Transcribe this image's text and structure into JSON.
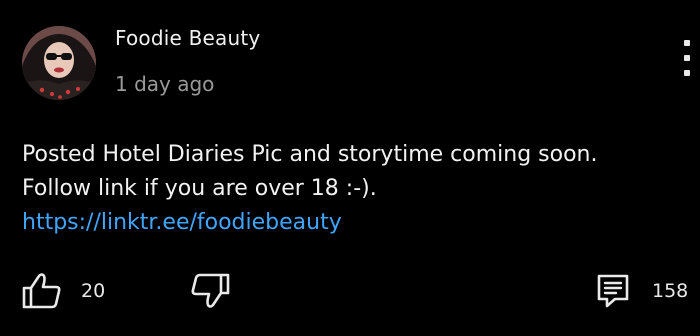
{
  "post": {
    "author": "Foodie Beauty",
    "timestamp": "1 day ago",
    "text_line1": "Posted Hotel Diaries Pic and storytime coming soon.",
    "text_line2": "Follow link if you are over 18 :-).",
    "link": "https://linktr.ee/foodiebeauty"
  },
  "actions": {
    "like_count": "20",
    "comment_count": "158"
  },
  "icons": {
    "avatar": "avatar",
    "menu": "more-vert-icon",
    "like": "thumbs-up-icon",
    "dislike": "thumbs-down-icon",
    "comment": "comment-icon"
  },
  "colors": {
    "background": "#000000",
    "text": "#f2f2f2",
    "secondary_text": "#9a9a9a",
    "link": "#3ea6ff"
  }
}
